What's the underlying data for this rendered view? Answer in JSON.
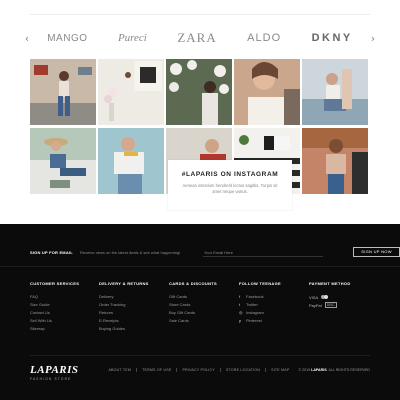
{
  "brands": {
    "prev_arrow": "‹",
    "next_arrow": "›",
    "items": [
      "MANGO",
      "Pureci",
      "ZARA",
      "ALDO",
      "DKNY"
    ]
  },
  "instagram": {
    "title": "#LAPARIS ON INSTAGRAM",
    "text": "Aenean interdum hendrerit lectus sagittis. Turpis sit amet neque varius."
  },
  "signup": {
    "label": "SIGN UP FOR EMAIL",
    "description": "Receive news on the latest deals & see what happening!",
    "placeholder": "Your Email Here",
    "button": "SIGN UP NOW"
  },
  "columns": {
    "customer": {
      "heading": "CUSTOMER SERVICES",
      "items": [
        "FAQ",
        "Size Guide",
        "Contact Us",
        "Sell With Us",
        "Sitemap"
      ]
    },
    "delivery": {
      "heading": "DELIVERY & RETURNS",
      "items": [
        "Delivery",
        "Order Tracking",
        "Returns",
        "E-Receipts",
        "Buying Guides"
      ]
    },
    "cards": {
      "heading": "CARDS & DISCOUNTS",
      "items": [
        "Gift Cards",
        "Store Cards",
        "Buy Gift Cards",
        "Sale Cards"
      ]
    },
    "follow": {
      "heading": "FOLLOW TEENAGE",
      "items": [
        "Facebook",
        "Twitter",
        "Instagram",
        "Pinterest"
      ]
    },
    "payment": {
      "heading": "PAYMENT METHOD",
      "visa": "VISA",
      "paypal": "PayPal",
      "other": "DISC"
    }
  },
  "footer_bottom": {
    "logo": "LAPARIS",
    "tagline": "FASHION STORE",
    "links": [
      "ABOUT TEM",
      "TERMS OF USE",
      "PRIVACY POLICY",
      "STORE LOCATION",
      "SITE MAP"
    ],
    "copyright_prefix": "© 2019",
    "copyright_brand": "LAPARIS",
    "copyright_suffix": "ALL RIGHTS RESERVED"
  },
  "colors": {
    "footer_bg": "#0b0b0b",
    "page_bg": "#ffffff",
    "brand_text": "#8a8a8a"
  },
  "icons": {
    "social": [
      "facebook-icon",
      "twitter-icon",
      "instagram-icon",
      "pinterest-icon"
    ]
  }
}
